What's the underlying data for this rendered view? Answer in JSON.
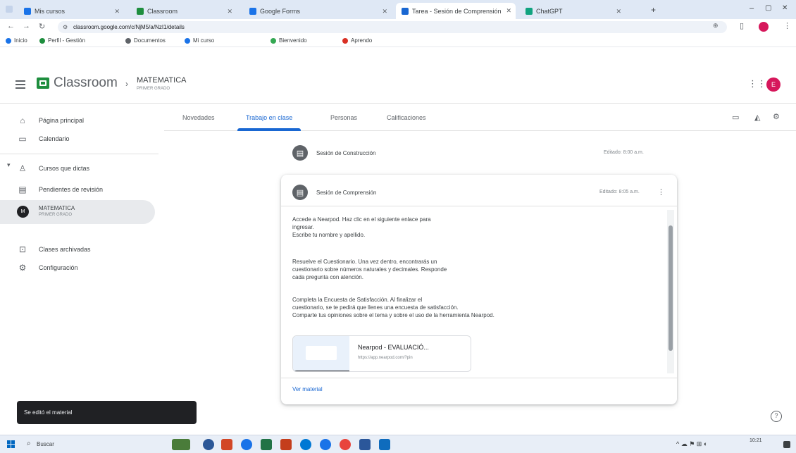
{
  "browser": {
    "tabs": [
      {
        "title": "Mis cursos",
        "color": "#1a73e8"
      },
      {
        "title": "Classroom",
        "color": "#1e8e3e"
      },
      {
        "title": "Google Forms",
        "color": "#1a73e8"
      },
      {
        "title": "Tarea - Sesión de Comprensión",
        "color": "#1967d2"
      },
      {
        "title": "ChatGPT",
        "color": "#10a37f"
      }
    ],
    "url": "classroom.google.com/c/NjM5/a/NzI1/details",
    "bookmarks": [
      {
        "label": "Inicio",
        "color": "#1a73e8"
      },
      {
        "label": "Perfil - Gestión",
        "color": "#1e8e3e"
      },
      {
        "label": "Documentos",
        "color": "#5f6368"
      },
      {
        "label": "Mi curso",
        "color": "#1a73e8"
      },
      {
        "label": "Bienvenido",
        "color": "#34a853"
      },
      {
        "label": "Aprendo",
        "color": "#d93025"
      }
    ]
  },
  "app": {
    "brand": "Classroom",
    "course": "MATEMATICA",
    "course_sub": "PRIMER GRADO",
    "avatar": "E"
  },
  "sidebar": {
    "items": [
      {
        "label": "Página principal",
        "icon": "home-icon"
      },
      {
        "label": "Calendario",
        "icon": "calendar-icon"
      },
      {
        "label": "Cursos que dictas",
        "icon": "people-icon"
      },
      {
        "label": "Pendientes de revisión",
        "icon": "folder-icon"
      },
      {
        "label": "MATEMATICA",
        "sub": "PRIMER GRADO",
        "avatar": "M",
        "icon": "course-avatar"
      },
      {
        "label": "Clases archivadas",
        "icon": "archive-icon"
      },
      {
        "label": "Configuración",
        "icon": "gear-icon"
      }
    ]
  },
  "course_tabs": [
    "Novedades",
    "Trabajo en clase",
    "Personas",
    "Calificaciones"
  ],
  "active_tab": 1,
  "materials": [
    {
      "title": "Sesión de Construcción",
      "meta": "Editado: 8:00 a.m."
    },
    {
      "title": "Sesión de Comprensión",
      "meta": "Editado: 8:05 a.m."
    }
  ],
  "expanded": {
    "paragraphs": [
      [
        "Accede a Nearpod. Haz clic en el siguiente enlace para",
        "ingresar.",
        "Escribe tu nombre y apellido."
      ],
      [
        "Resuelve el Cuestionario. Una vez dentro, encontrarás un",
        "cuestionario sobre números naturales y decimales. Responde",
        "cada pregunta con atención."
      ],
      [
        "Completa la Encuesta de Satisfacción. Al finalizar el",
        "cuestionario, se te pedirá que llenes una encuesta de satisfacción.",
        "Comparte tus opiniones sobre el tema y sobre el uso de la herramienta Nearpod."
      ]
    ],
    "attachment_title": "Nearpod - EVALUACIÓ...",
    "attachment_url": "https://app.nearpod.com/?pin",
    "view_material": "Ver material"
  },
  "toast": "Se editó el material",
  "taskbar": {
    "search": "Buscar",
    "time": "10:21"
  }
}
